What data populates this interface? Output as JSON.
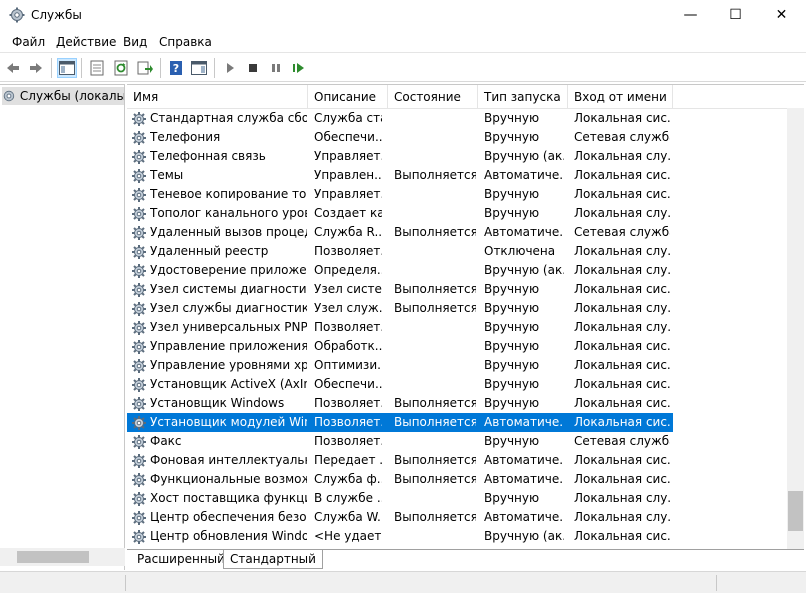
{
  "window": {
    "title": "Службы",
    "minimize_glyph": "—",
    "maximize_glyph": "☐",
    "close_glyph": "✕"
  },
  "menu": {
    "items": [
      "Файл",
      "Действие",
      "Вид",
      "Справка"
    ]
  },
  "toolbar": {
    "icons": [
      "back-icon",
      "forward-icon",
      "show-console-tree-icon",
      "properties-icon",
      "refresh-icon",
      "export-list-icon",
      "help-icon",
      "show-action-pane-icon",
      "start-service-icon",
      "stop-service-icon",
      "pause-service-icon",
      "resume-service-icon"
    ]
  },
  "tree": {
    "root_label": "Службы (локалы"
  },
  "list": {
    "columns": [
      "Имя",
      "Описание",
      "Состояние",
      "Тип запуска",
      "Вход от имени"
    ],
    "rows": [
      {
        "name": "Стандартная служба сбор...",
        "desc": "Служба ста...",
        "state": "",
        "start": "Вручную",
        "logon": "Локальная сис..."
      },
      {
        "name": "Телефония",
        "desc": "Обеспечи...",
        "state": "",
        "start": "Вручную",
        "logon": "Сетевая служба"
      },
      {
        "name": "Телефонная связь",
        "desc": "Управляет...",
        "state": "",
        "start": "Вручную (ак...",
        "logon": "Локальная слу..."
      },
      {
        "name": "Темы",
        "desc": "Управлен...",
        "state": "Выполняется",
        "start": "Автоматиче...",
        "logon": "Локальная сис..."
      },
      {
        "name": "Теневое копирование тома",
        "desc": "Управляет...",
        "state": "",
        "start": "Вручную",
        "logon": "Локальная сис..."
      },
      {
        "name": "Тополог канального уровня",
        "desc": "Создает ка...",
        "state": "",
        "start": "Вручную",
        "logon": "Локальная слу..."
      },
      {
        "name": "Удаленный вызов процеду...",
        "desc": "Служба R...",
        "state": "Выполняется",
        "start": "Автоматиче...",
        "logon": "Сетевая служба"
      },
      {
        "name": "Удаленный реестр",
        "desc": "Позволяет...",
        "state": "",
        "start": "Отключена",
        "logon": "Локальная слу..."
      },
      {
        "name": "Удостоверение приложения",
        "desc": "Определя...",
        "state": "",
        "start": "Вручную (ак...",
        "logon": "Локальная слу..."
      },
      {
        "name": "Узел системы диагностики",
        "desc": "Узел систе...",
        "state": "Выполняется",
        "start": "Вручную",
        "logon": "Локальная сис..."
      },
      {
        "name": "Узел службы диагностики",
        "desc": "Узел служ...",
        "state": "Выполняется",
        "start": "Вручную",
        "logon": "Локальная слу..."
      },
      {
        "name": "Узел универсальных PNP-...",
        "desc": "Позволяет...",
        "state": "",
        "start": "Вручную",
        "logon": "Локальная слу..."
      },
      {
        "name": "Управление приложениями",
        "desc": "Обработк...",
        "state": "",
        "start": "Вручную",
        "logon": "Локальная сис..."
      },
      {
        "name": "Управление уровнями хра...",
        "desc": "Оптимизи...",
        "state": "",
        "start": "Вручную",
        "logon": "Локальная сис..."
      },
      {
        "name": "Установщик ActiveX (AxIns...",
        "desc": "Обеспечи...",
        "state": "",
        "start": "Вручную",
        "logon": "Локальная сис..."
      },
      {
        "name": "Установщик Windows",
        "desc": "Позволяет...",
        "state": "Выполняется",
        "start": "Вручную",
        "logon": "Локальная сис..."
      },
      {
        "name": "Установщик модулей Win...",
        "desc": "Позволяет...",
        "state": "Выполняется",
        "start": "Автоматиче...",
        "logon": "Локальная сис...",
        "selected": true
      },
      {
        "name": "Факс",
        "desc": "Позволяет...",
        "state": "",
        "start": "Вручную",
        "logon": "Сетевая служба"
      },
      {
        "name": "Фоновая интеллектуальна...",
        "desc": "Передает ...",
        "state": "Выполняется",
        "start": "Автоматиче...",
        "logon": "Локальная сис..."
      },
      {
        "name": "Функциональные возмож...",
        "desc": "Служба ф...",
        "state": "Выполняется",
        "start": "Автоматиче...",
        "logon": "Локальная сис..."
      },
      {
        "name": "Хост поставщика функции...",
        "desc": "В службе ...",
        "state": "",
        "start": "Вручную",
        "logon": "Локальная слу..."
      },
      {
        "name": "Центр обеспечения безоп...",
        "desc": "Служба W...",
        "state": "Выполняется",
        "start": "Автоматиче...",
        "logon": "Локальная слу..."
      },
      {
        "name": "Центр обновления Windows",
        "desc": "<Не удает...",
        "state": "",
        "start": "Вручную (ак...",
        "logon": "Локальная сис..."
      }
    ]
  },
  "tabs": [
    "Расширенный",
    "Стандартный"
  ],
  "colors": {
    "selection": "#0078d7",
    "active_toolbar": "#cce8ff"
  }
}
